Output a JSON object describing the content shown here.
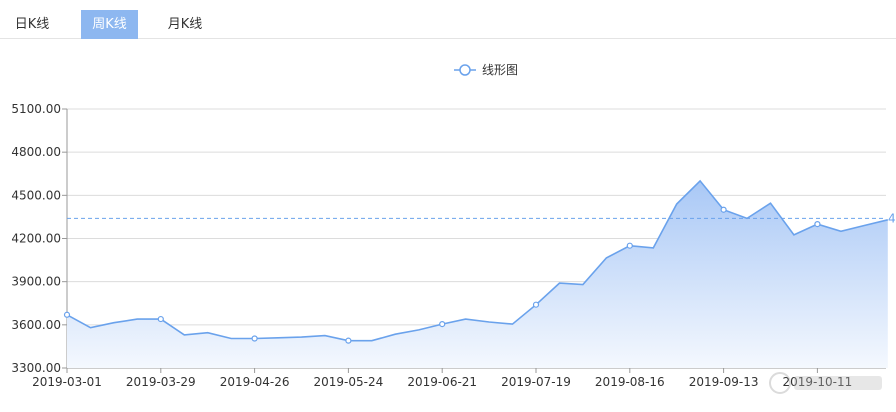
{
  "tabs": [
    {
      "label": "日K线",
      "active": false
    },
    {
      "label": "周K线",
      "active": true
    },
    {
      "label": "月K线",
      "active": false
    }
  ],
  "chart_data": {
    "type": "area",
    "legend": {
      "label": "线形图",
      "placement": "top-center"
    },
    "ylim": [
      3300,
      5100
    ],
    "yticks": [
      "3300.00",
      "3600.00",
      "3900.00",
      "4200.00",
      "4500.00",
      "4800.00",
      "5100.00"
    ],
    "xtick_labels": [
      "2019-03-01",
      "2019-03-29",
      "2019-04-26",
      "2019-05-24",
      "2019-06-21",
      "2019-07-19",
      "2019-08-16",
      "2019-09-13",
      "2019-10-11"
    ],
    "average_line": {
      "value": 4340,
      "label": "4"
    },
    "grid": true,
    "colors": {
      "line": "#6aa2ec",
      "fill_top": "#a9c8f6",
      "fill_bottom": "#f4f8fe",
      "average": "#6aa2ec",
      "tab_active": "#8db7f0"
    },
    "series": [
      {
        "x": [
          "2019-03-01",
          "2019-03-08",
          "2019-03-15",
          "2019-03-22",
          "2019-03-29",
          "2019-04-05",
          "2019-04-12",
          "2019-04-19",
          "2019-04-26",
          "2019-05-03",
          "2019-05-10",
          "2019-05-17",
          "2019-05-24",
          "2019-05-31",
          "2019-06-07",
          "2019-06-14",
          "2019-06-21",
          "2019-06-28",
          "2019-07-05",
          "2019-07-12",
          "2019-07-19",
          "2019-07-26",
          "2019-08-02",
          "2019-08-09",
          "2019-08-16",
          "2019-08-23",
          "2019-08-30",
          "2019-09-06",
          "2019-09-13",
          "2019-09-20",
          "2019-09-27",
          "2019-10-04",
          "2019-10-11",
          "2019-10-18",
          "2019-10-25",
          "2019-11-01"
        ],
        "values": [
          3670,
          3580,
          3615,
          3640,
          3640,
          3530,
          3545,
          3505,
          3505,
          3510,
          3515,
          3525,
          3490,
          3490,
          3535,
          3565,
          3605,
          3640,
          3620,
          3605,
          3740,
          3890,
          3880,
          4065,
          4150,
          4135,
          4440,
          4600,
          4400,
          4340,
          4445,
          4225,
          4300,
          4250,
          4290,
          4330
        ]
      }
    ]
  }
}
